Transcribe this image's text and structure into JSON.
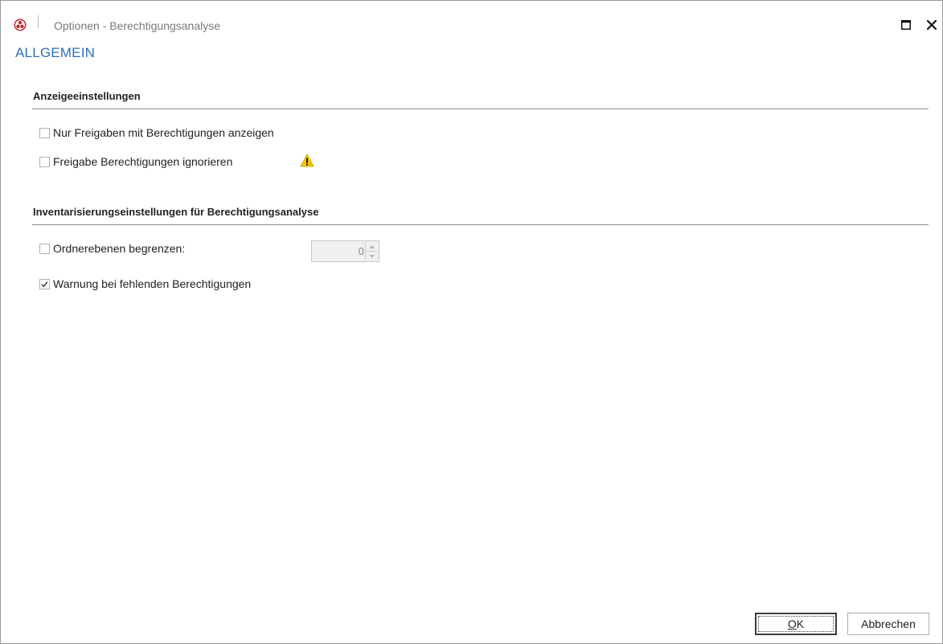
{
  "window": {
    "title": "Optionen - Berechtigungsanalyse",
    "icon": "app-logo-icon",
    "controls": [
      "maximize-icon",
      "close-icon"
    ]
  },
  "page": {
    "heading": "ALLGEMEIN"
  },
  "sections": [
    {
      "title": "Anzeigeeinstellungen",
      "options": [
        {
          "label": "Nur Freigaben mit Berechtigungen anzeigen",
          "checked": false
        },
        {
          "label": "Freigabe Berechtigungen ignorieren",
          "checked": false,
          "icon": "warning-icon"
        }
      ]
    },
    {
      "title": "Inventarisierungseinstellungen für Berechtigungsanalyse",
      "options": [
        {
          "label": "Ordnerebenen begrenzen:",
          "checked": false
        },
        {
          "label": "Warnung bei fehlenden Berechtigungen",
          "checked": true
        }
      ]
    }
  ],
  "folder_levels": {
    "value": "0",
    "enabled": false
  },
  "buttons": {
    "ok_mnemonic": "O",
    "ok_rest": "K",
    "cancel": "Abbrechen"
  },
  "colors": {
    "heading": "#2a6fb7",
    "warning": "#f5c400",
    "logo": "#c0282d"
  }
}
